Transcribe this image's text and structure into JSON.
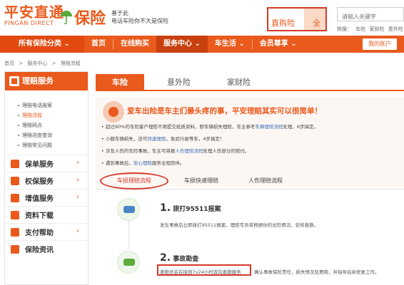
{
  "header": {
    "logo_main": "平安直通",
    "logo_sub": "PINGAN DIRECT",
    "brand": "保险",
    "slogan_line1": "基于此",
    "slogan_line2": "电话车险你不大是保险",
    "promo_text1": "直购险",
    "promo_text2": "全",
    "search_placeholder": "请输入关键字",
    "hot_links": [
      "热搜：",
      "车险",
      "家财险",
      "意外险"
    ]
  },
  "nav": {
    "all_categories": "所有保险分类",
    "items": [
      "首页",
      "在线购买",
      "服务中心",
      "车生活",
      "会员尊享"
    ],
    "user_button": "我的账户"
  },
  "breadcrumb": [
    "首页",
    ">",
    "服务中心",
    ">",
    "理赔流程"
  ],
  "sidebar": {
    "head": "理赔服务",
    "sub_items": [
      "理赔电话报案",
      "理赔流程",
      "理赔网点",
      "理赔进度查询",
      "理赔常见问题"
    ],
    "items": [
      {
        "label": "保单服务"
      },
      {
        "label": "权保服务"
      },
      {
        "label": "增值服务"
      },
      {
        "label": "资料下载"
      },
      {
        "label": "支付帮助"
      },
      {
        "label": "保险资讯"
      }
    ]
  },
  "tabs": [
    "车险",
    "意外险",
    "家财险"
  ],
  "banner": {
    "title": "爱车出险是车主们最头疼的事，平安理赔其实可以很简单！",
    "lines": [
      {
        "pre": "• 超过90%的车险客户理赔不用提交纸质资料，即车辆损失理赔，车主参考",
        "link": "车辆理赔流程",
        "post": "处理，6步搞定。"
      },
      {
        "pre": "• 小额车辆损失，还可",
        "link": "快速理赔",
        "post": "，免验行驶等车，4步搞定！"
      },
      {
        "pre": "• 涉及人伤的车险事故，车主可将报",
        "link": "人伤理赔流程",
        "post": "处理人伤部分的赔付。"
      },
      {
        "pre": "• 遇到事故后，",
        "link": "安心理赔",
        "post": "服务全程陪伴。"
      }
    ]
  },
  "subtabs": [
    "车损理赔流程",
    "车损快速理赔",
    "人伤理赔流程"
  ],
  "steps": [
    {
      "num": "1.",
      "title": "拨打95511报案",
      "desc": "发生事故后立即拨打95511报案，理赔专员将根据你的出险情况，安排查勘。"
    },
    {
      "num": "2.",
      "title": "事故勘查",
      "desc_highlight": "查勘员会在接到7x24小时双向查勘服务",
      "desc_rest": "确认事故保险责任，损失情况及费用，并指导后续修复工作。"
    }
  ]
}
